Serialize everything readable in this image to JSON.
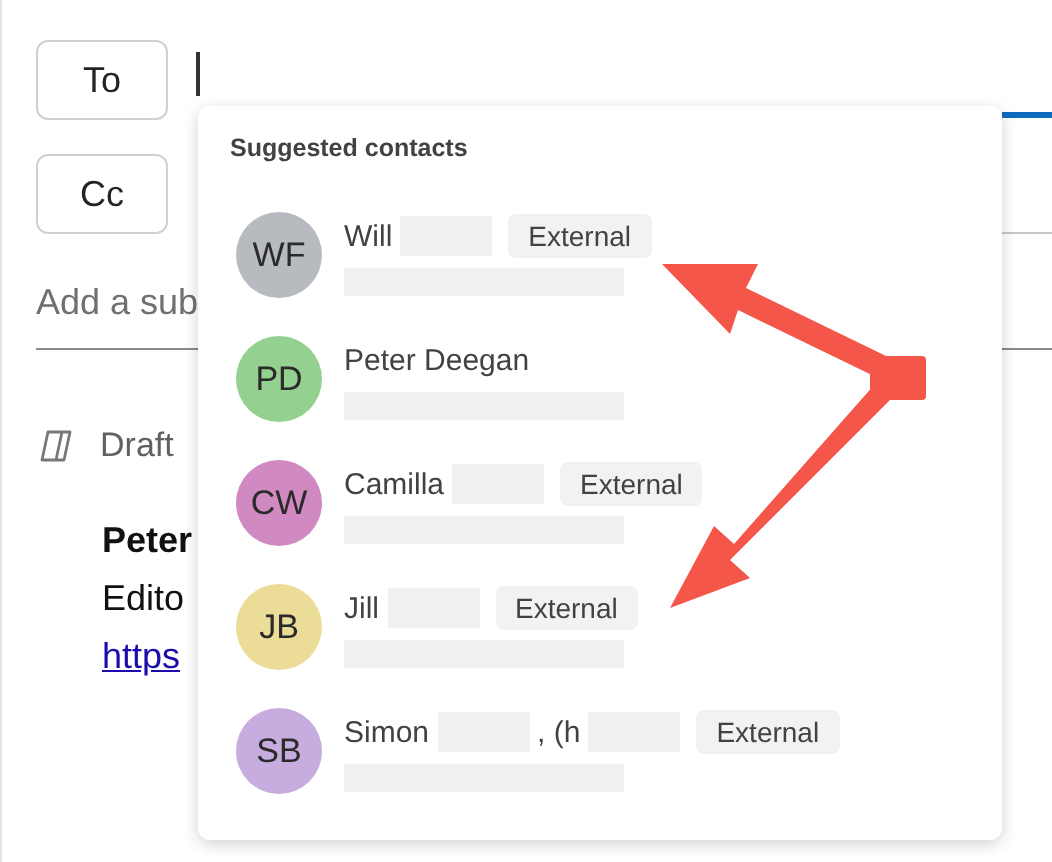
{
  "compose": {
    "to_button": "To",
    "cc_button": "Cc",
    "subject_placeholder": "Add a sub",
    "draft_label": "Draft",
    "signature_name": "Peter",
    "signature_title": "Edito",
    "signature_link": "https"
  },
  "suggestions": {
    "heading": "Suggested contacts",
    "contacts": [
      {
        "initials": "WF",
        "color": "#b7babe",
        "name": [
          {
            "kind": "text",
            "text": "Will"
          },
          {
            "kind": "redacted"
          }
        ],
        "external": true,
        "badge": "External"
      },
      {
        "initials": "PD",
        "color": "#94d08f",
        "name": [
          {
            "kind": "text",
            "text": "Peter Deegan"
          }
        ],
        "external": false
      },
      {
        "initials": "CW",
        "color": "#d08ac1",
        "name": [
          {
            "kind": "text",
            "text": "Camilla"
          },
          {
            "kind": "redacted"
          }
        ],
        "external": true,
        "badge": "External"
      },
      {
        "initials": "JB",
        "color": "#ebdc98",
        "name": [
          {
            "kind": "text",
            "text": "Jill"
          },
          {
            "kind": "redacted"
          }
        ],
        "external": true,
        "badge": "External"
      },
      {
        "initials": "SB",
        "color": "#c6acdf",
        "name": [
          {
            "kind": "text",
            "text": "Simon"
          },
          {
            "kind": "redacted"
          },
          {
            "kind": "text",
            "text": ", (h"
          },
          {
            "kind": "redacted"
          }
        ],
        "external": true,
        "badge": "External"
      }
    ]
  }
}
